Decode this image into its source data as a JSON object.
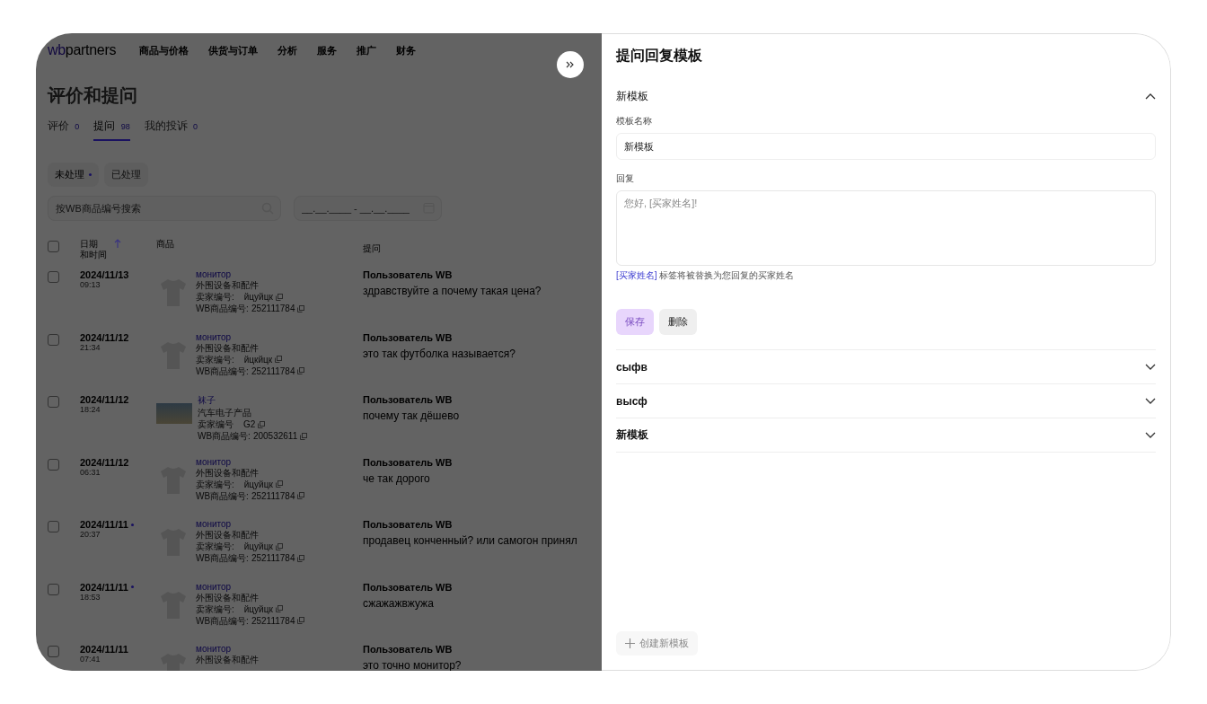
{
  "nav": {
    "logo": {
      "part1": "wb",
      "part2": "partners"
    },
    "items": [
      "商品与价格",
      "供货与订单",
      "分析",
      "服务",
      "推广",
      "财务"
    ]
  },
  "page": {
    "title": "评价和提问",
    "tabs": [
      {
        "label": "评价",
        "count": "0",
        "selected": false
      },
      {
        "label": "提问",
        "count": "98",
        "selected": true
      },
      {
        "label": "我的投诉",
        "count": "0",
        "selected": false
      }
    ],
    "filters": [
      {
        "label": "未处理",
        "selected": true,
        "dot": true
      },
      {
        "label": "已处理",
        "selected": false,
        "dot": false
      }
    ],
    "search": {
      "placeholder": "按WB商品编号搜索"
    },
    "date_range": {
      "placeholder": "__.__.____ - __.__.____"
    },
    "table": {
      "select_all": {
        "checked": false
      },
      "columns": [
        {
          "line1": "日期",
          "line2": "和时间"
        },
        {
          "line1": "商品"
        },
        {
          "line1": "提问"
        }
      ],
      "rows": [
        {
          "checked": false,
          "date": "2024/11/13",
          "time": "09:13",
          "unread": false,
          "thumbnail": {
            "kind": "shirt"
          },
          "product": "монитор",
          "category": "外围设备和配件",
          "seller_label": "卖家编号:",
          "seller_code": "йцуйцк",
          "wb_label": "WB商品编号:",
          "wb_code": "252111784",
          "user": "Пользователь WB",
          "question": "здравствуйте а почему такая цена?"
        },
        {
          "checked": false,
          "date": "2024/11/12",
          "time": "21:34",
          "unread": false,
          "thumbnail": {
            "kind": "shirt"
          },
          "product": "монитор",
          "category": "外围设备和配件",
          "seller_label": "卖家编号:",
          "seller_code": "йцкйцк",
          "wb_label": "WB商品编号:",
          "wb_code": "252111784",
          "user": "Пользователь WB",
          "question": "это так футболка называется?"
        },
        {
          "checked": false,
          "date": "2024/11/12",
          "time": "18:24",
          "unread": false,
          "thumbnail": {
            "kind": "photo"
          },
          "product": "袜子",
          "category": "汽车电子产品",
          "seller_label": "卖家编号",
          "seller_code": "G2",
          "wb_label": "WB商品编号:",
          "wb_code": "200532611",
          "user": "Пользователь WB",
          "question": "почему так дёшево"
        },
        {
          "checked": false,
          "date": "2024/11/12",
          "time": "06:31",
          "unread": false,
          "thumbnail": {
            "kind": "shirt"
          },
          "product": "монитор",
          "category": "外围设备和配件",
          "seller_label": "卖家编号:",
          "seller_code": "йцуйцк",
          "wb_label": "WB商品编号:",
          "wb_code": "252111784",
          "user": "Пользователь WB",
          "question": "че так дорого"
        },
        {
          "checked": false,
          "date": "2024/11/11",
          "time": "20:37",
          "unread": true,
          "thumbnail": {
            "kind": "shirt"
          },
          "product": "монитор",
          "category": "外围设备和配件",
          "seller_label": "卖家编号:",
          "seller_code": "йцуйцк",
          "wb_label": "WB商品编号:",
          "wb_code": "252111784",
          "user": "Пользователь WB",
          "question": "продавец конченный? или самогон принял"
        },
        {
          "checked": false,
          "date": "2024/11/11",
          "time": "18:53",
          "unread": true,
          "thumbnail": {
            "kind": "shirt"
          },
          "product": "монитор",
          "category": "外围设备和配件",
          "seller_label": "卖家编号:",
          "seller_code": "йцуйцк",
          "wb_label": "WB商品编号:",
          "wb_code": "252111784",
          "user": "Пользователь WB",
          "question": "сжажажвжужа"
        },
        {
          "checked": false,
          "date": "2024/11/11",
          "time": "07:41",
          "unread": false,
          "thumbnail": {
            "kind": "shirt"
          },
          "product": "монитор",
          "category": "外围设备和配件",
          "user": "Пользователь WB",
          "question": "это точно монитор?"
        }
      ]
    }
  },
  "panel": {
    "title": "提问回复模板",
    "editor": {
      "name": "新模板",
      "name_label": "模板名称",
      "name_value": "新模板",
      "reply_label": "回复",
      "reply_placeholder": "您好, [买家姓名]!",
      "hint_tag": "[买家姓名]",
      "hint_text": "标签将被替换为您回复的买家姓名",
      "save": {
        "label": "保存",
        "disabled": true
      },
      "delete": {
        "label": "删除",
        "disabled": false
      }
    },
    "templates": [
      {
        "name": "сыфв",
        "expanded": false
      },
      {
        "name": "высф",
        "expanded": false
      },
      {
        "name": "新模板",
        "expanded": false
      }
    ],
    "create": {
      "label": "创建新模板",
      "disabled": true
    }
  }
}
